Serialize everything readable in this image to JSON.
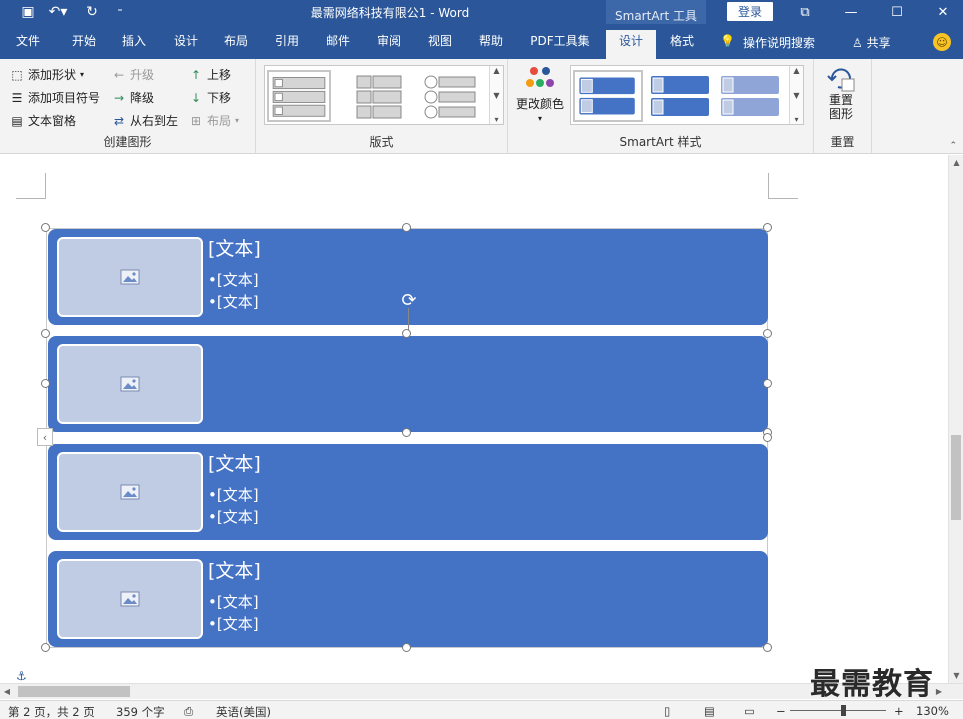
{
  "title_bar": {
    "doc_title": "最需网络科技有限公1  -  Word",
    "contextual_tab_group": "SmartArt 工具",
    "login_label": "登录"
  },
  "tabs": [
    {
      "label": "文件"
    },
    {
      "label": "开始"
    },
    {
      "label": "插入"
    },
    {
      "label": "设计"
    },
    {
      "label": "布局"
    },
    {
      "label": "引用"
    },
    {
      "label": "邮件"
    },
    {
      "label": "审阅"
    },
    {
      "label": "视图"
    },
    {
      "label": "帮助"
    },
    {
      "label": "PDF工具集"
    },
    {
      "label": "设计",
      "active": true
    },
    {
      "label": "格式"
    }
  ],
  "tell_me": "操作说明搜索",
  "share": "共享",
  "ribbon": {
    "create_graphic": {
      "add_shape": "添加形状",
      "add_bullet": "添加项目符号",
      "text_pane": "文本窗格",
      "promote": "升级",
      "demote": "降级",
      "right_to_left": "从右到左",
      "move_up": "上移",
      "move_down": "下移",
      "layout": "布局",
      "group_label": "创建图形"
    },
    "layouts": {
      "group_label": "版式"
    },
    "styles": {
      "change_colors": "更改颜色",
      "group_label": "SmartArt 样式"
    },
    "reset": {
      "reset_graphic_line1": "重置",
      "reset_graphic_line2": "图形",
      "group_label": "重置"
    }
  },
  "smartart": {
    "rows": [
      {
        "title": "[文本]",
        "bullets": [
          "•[文本]",
          "•[文本]"
        ]
      },
      {
        "title": "",
        "bullets": []
      },
      {
        "title": "[文本]",
        "bullets": [
          "•[文本]",
          "•[文本]"
        ]
      },
      {
        "title": "[文本]",
        "bullets": [
          "•[文本]",
          "•[文本]"
        ]
      }
    ]
  },
  "status_bar": {
    "page": "第 2 页，共 2 页",
    "words": "359 个字",
    "language": "英语(美国)",
    "zoom": "130%"
  },
  "watermark": "最需教育",
  "colors": {
    "accent": "#2b579a",
    "smartart_fill": "#4472c4",
    "picture_fill": "#c0cbe4"
  }
}
